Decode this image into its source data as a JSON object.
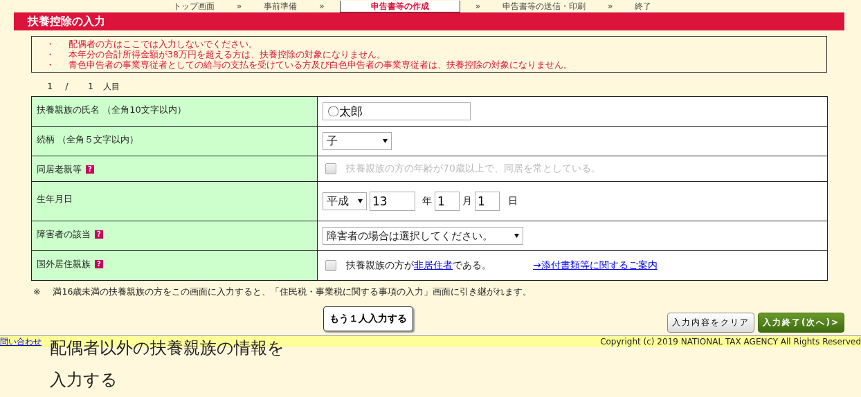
{
  "steps": [
    {
      "label": "トップ画面",
      "selected": false
    },
    {
      "label": "事前準備",
      "selected": false
    },
    {
      "label": "申告書等の作成",
      "selected": true
    },
    {
      "label": "申告書等の送信・印刷",
      "selected": false
    },
    {
      "label": "終了",
      "selected": false
    }
  ],
  "step_separator": "»",
  "title": "扶養控除の入力",
  "notices": [
    {
      "bullet": "・",
      "text": "配偶者の方はここでは入力しないでください。"
    },
    {
      "bullet": "・",
      "text": "本年分の合計所得金額が38万円を超える方は、扶養控除の対象になりません。"
    },
    {
      "bullet": "・",
      "text": "青色申告者の事業専従者としての給与の支払を受けている方及び白色申告者の事業専従者は、扶養控除の対象になりません。"
    }
  ],
  "counter": {
    "current": "1",
    "separator": "/",
    "total": "1",
    "unit": "人目"
  },
  "rows": [
    {
      "kind": "text",
      "label": "扶養親族の氏名 （全角10文字以内）",
      "help": false,
      "value": "〇太郎"
    },
    {
      "kind": "select",
      "label": "続柄 （全角５文字以内）",
      "help": false,
      "value": "子"
    },
    {
      "kind": "checkbox",
      "label": "同居老親等",
      "help": true,
      "help_mark": "?",
      "checked": false,
      "disabled": true,
      "text": "扶養親族の方の年齢が70歳以上で、同居を常としている。"
    },
    {
      "kind": "date",
      "label": "生年月日",
      "help": false,
      "era": "平成",
      "year": "13",
      "year_unit": "年",
      "month": "1",
      "month_unit": "月",
      "day": "1",
      "day_unit": "日"
    },
    {
      "kind": "select",
      "label": "障害者の該当",
      "help": true,
      "help_mark": "?",
      "value": "障害者の場合は選択してください。"
    },
    {
      "kind": "checkbox",
      "label": "国外居住親族",
      "help": true,
      "help_mark": "?",
      "checked": false,
      "disabled": false,
      "text_before": "扶養親族の方が",
      "link": "非居住者",
      "text_after": "である。",
      "extra_link": "→添付書類等に関するご案内"
    }
  ],
  "note": {
    "mark": "※",
    "text": "満16歳未満の扶養親族の方をこの画面に入力すると、「住民税・事業税に関する事項の入力」画面に引き継がれます。"
  },
  "add_button": "もう１人入力する",
  "clear_button": "入力内容をクリア",
  "next_button": "入力終了(次へ)>",
  "footer": {
    "links": [
      "問い合わせ"
    ],
    "copyright": "Copyright (c) 2019 NATIONAL TAX AGENCY All Rights Reserved"
  },
  "caption": "配偶者以外の扶養親族の情報を入力する"
}
